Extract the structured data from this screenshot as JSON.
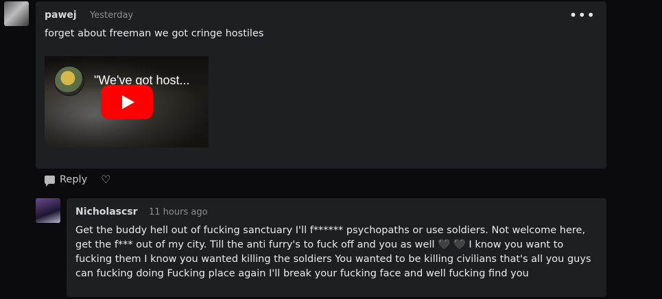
{
  "comments": [
    {
      "author": "pawej",
      "time": "Yesterday",
      "text": "forget about freeman we got cringe hostiles",
      "more_label": "•••",
      "video": {
        "title": "\"We've got host...",
        "icon": "youtube-play-icon"
      },
      "actions": {
        "reply_label": "Reply",
        "reply_icon": "comment-icon",
        "like_icon": "heart-icon",
        "like_glyph": "♡"
      }
    },
    {
      "author": "Nicholascsr",
      "time": "11 hours ago",
      "lines": [
        "Get the buddy hell out of fucking sanctuary I'll f****** psychopaths or use soldiers. Not welcome here,",
        "get the f*** out of my city. Till the anti furry's to fuck off and you as well 🖤 🖤  I know you want to",
        "fucking them I know you wanted killing the soldiers You wanted to be killing civilians that's all you guys",
        "can fucking doing Fucking place again I'll break your fucking face and well fucking find you"
      ]
    }
  ]
}
